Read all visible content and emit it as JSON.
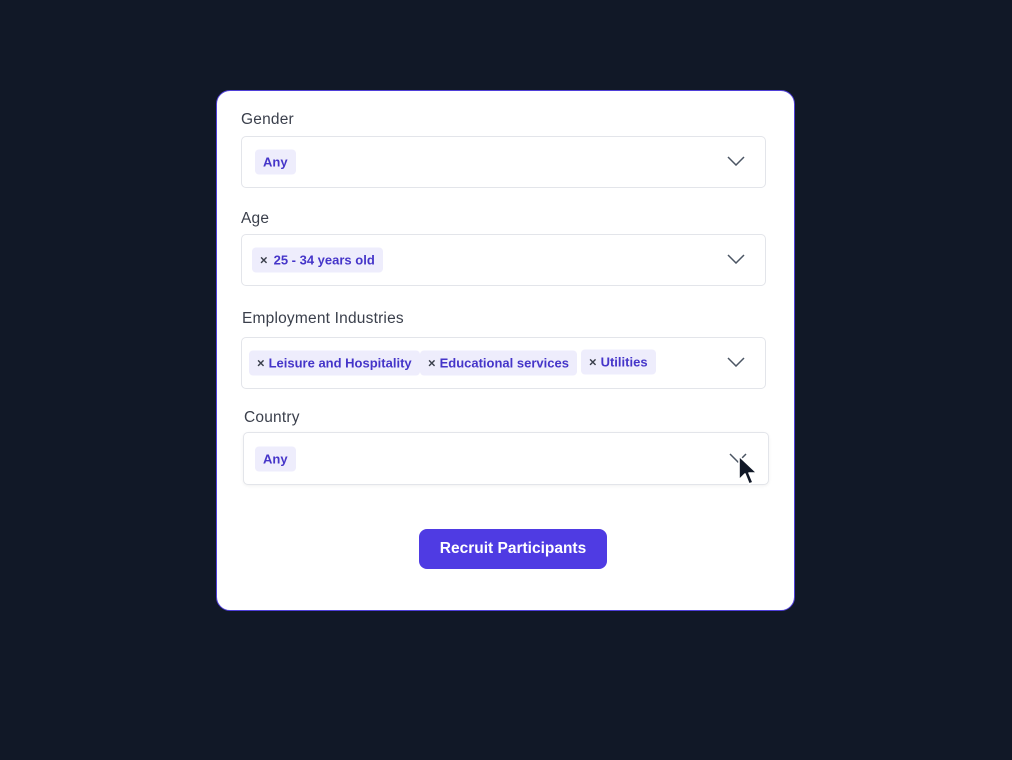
{
  "form": {
    "gender": {
      "label": "Gender",
      "values": [
        {
          "text": "Any",
          "removable": false
        }
      ]
    },
    "age": {
      "label": "Age",
      "values": [
        {
          "text": "25 - 34 years old",
          "removable": true
        }
      ]
    },
    "employment": {
      "label": "Employment Industries",
      "values": [
        {
          "text": "Leisure and Hospitality",
          "removable": true
        },
        {
          "text": "Educational services",
          "removable": true
        },
        {
          "text": "Utilities",
          "removable": true
        }
      ]
    },
    "country": {
      "label": "Country",
      "values": [
        {
          "text": "Any",
          "removable": false
        }
      ]
    },
    "remove_glyph": "×",
    "submit_label": "Recruit Participants"
  },
  "icons": {
    "dropdown": "chevron-down-icon",
    "remove": "close-icon",
    "pointer": "mouse-pointer-icon"
  },
  "colors": {
    "background": "#111827",
    "accent": "#4f3be3",
    "chip_bg": "#eeedfc",
    "chip_text": "#4535c9"
  }
}
